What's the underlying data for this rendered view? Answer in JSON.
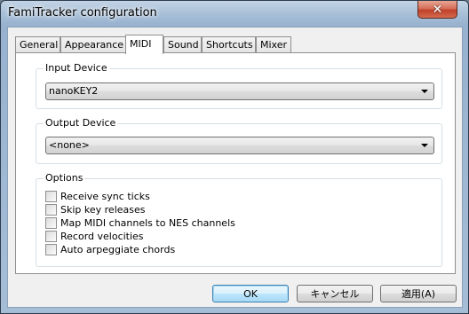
{
  "window": {
    "title": "FamiTracker configuration",
    "close_label": "✕"
  },
  "tabs": [
    {
      "label": "General"
    },
    {
      "label": "Appearance"
    },
    {
      "label": "MIDI"
    },
    {
      "label": "Sound"
    },
    {
      "label": "Shortcuts"
    },
    {
      "label": "Mixer"
    }
  ],
  "active_tab": "MIDI",
  "input_device": {
    "label": "Input Device",
    "value": "nanoKEY2"
  },
  "output_device": {
    "label": "Output Device",
    "value": "<none>"
  },
  "options": {
    "label": "Options",
    "items": [
      {
        "label": "Receive sync ticks",
        "checked": false
      },
      {
        "label": "Skip key releases",
        "checked": false
      },
      {
        "label": "Map MIDI channels to NES channels",
        "checked": false
      },
      {
        "label": "Record velocities",
        "checked": false
      },
      {
        "label": "Auto arpeggiate chords",
        "checked": false
      }
    ]
  },
  "buttons": {
    "ok": "OK",
    "cancel": "キャンセル",
    "apply": "適用(A)"
  }
}
